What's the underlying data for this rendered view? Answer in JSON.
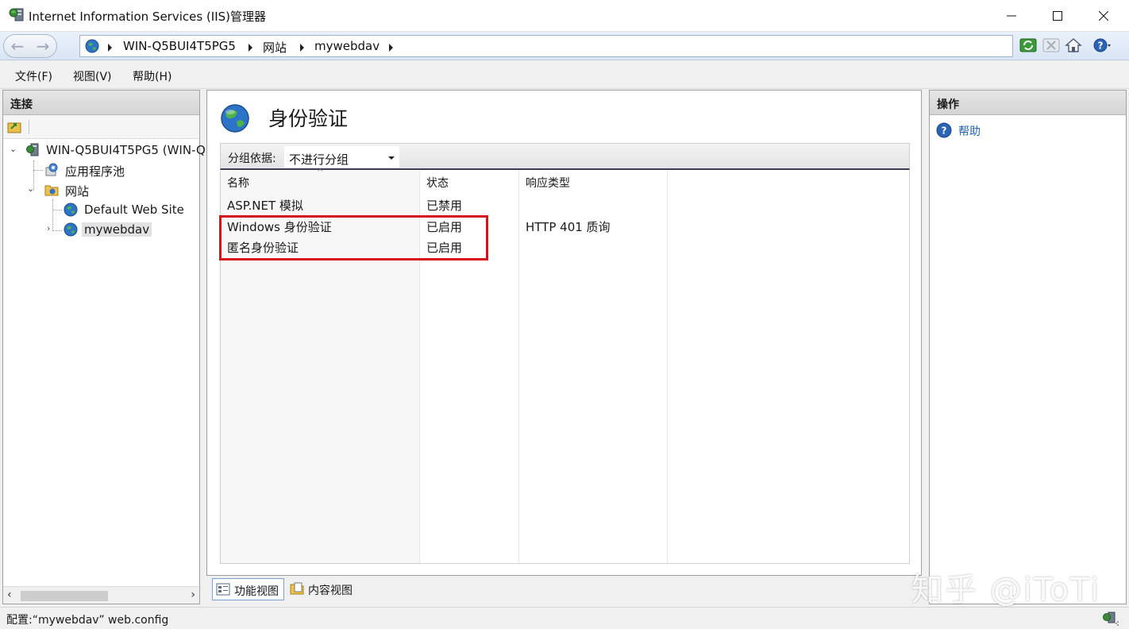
{
  "window": {
    "title": "Internet Information Services (IIS)管理器",
    "app_icon": "iis-manager-icon",
    "controls": [
      "minimize-icon",
      "maximize-icon",
      "close-icon"
    ]
  },
  "address_bar": {
    "breadcrumbs": [
      "WIN-Q5BUI4T5PG5",
      "网站",
      "mywebdav"
    ],
    "toolbar_icons": [
      "refresh-icon",
      "stop-icon",
      "home-icon",
      "help-icon"
    ]
  },
  "menu": {
    "items": [
      "文件(F)",
      "视图(V)",
      "帮助(H)"
    ]
  },
  "connections": {
    "header": "连接",
    "tree": [
      {
        "label": "WIN-Q5BUI4T5PG5 (WIN-Q",
        "icon": "server-icon",
        "expanded": true
      },
      {
        "label": "应用程序池",
        "icon": "app-pool-icon"
      },
      {
        "label": "网站",
        "icon": "sites-folder-icon",
        "expanded": true
      },
      {
        "label": "Default Web Site",
        "icon": "globe-icon"
      },
      {
        "label": "mywebdav",
        "icon": "globe-icon",
        "selected": true
      }
    ]
  },
  "feature": {
    "title": "身份验证",
    "icon": "authentication-globe-icon",
    "group_by_label": "分组依据:",
    "group_by_value": "不进行分组",
    "columns": [
      "名称",
      "状态",
      "响应类型"
    ],
    "rows": [
      {
        "name": "ASP.NET 模拟",
        "status": "已禁用",
        "response": ""
      },
      {
        "name": "Windows 身份验证",
        "status": "已启用",
        "response": "HTTP 401 质询"
      },
      {
        "name": "匿名身份验证",
        "status": "已启用",
        "response": ""
      }
    ],
    "highlight_color": "#d4151c"
  },
  "view_tabs": [
    "功能视图",
    "内容视图"
  ],
  "actions": {
    "header": "操作",
    "items": [
      "帮助"
    ]
  },
  "watermark": "知乎 @iToTi",
  "status_bar": {
    "text": "配置:“mywebdav” web.config"
  }
}
